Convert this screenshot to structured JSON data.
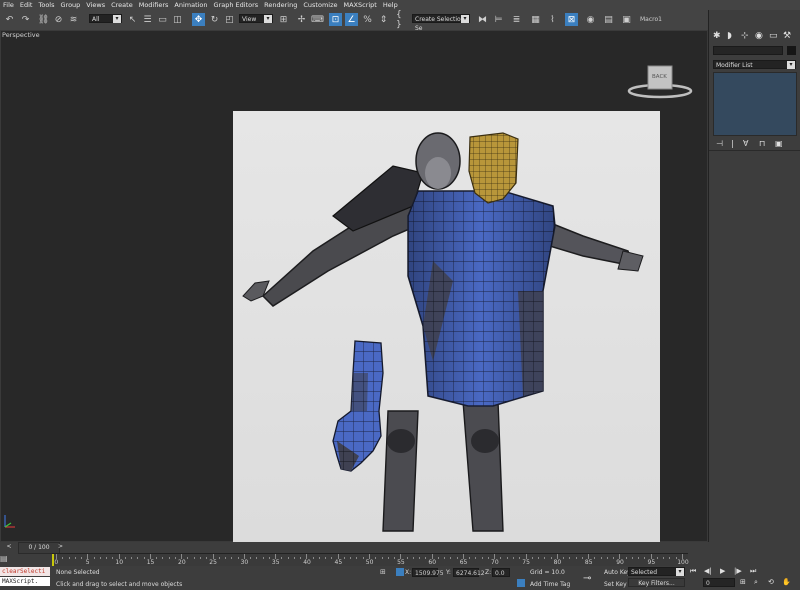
{
  "menu": [
    "File",
    "Edit",
    "Tools",
    "Group",
    "Views",
    "Create",
    "Modifiers",
    "Animation",
    "Graph Editors",
    "Rendering",
    "Customize",
    "MAXScript",
    "Help"
  ],
  "toolbar": {
    "filter_value": "All",
    "refcoord_value": "View",
    "named_selection_placeholder": "Create Selection Se",
    "macro_label": "Macro1"
  },
  "viewport": {
    "label": "Perspective",
    "viewcube_label": "BACK"
  },
  "right_panel": {
    "modifier_list_label": "Modifier List"
  },
  "timeline": {
    "frame_counter": "0 / 100",
    "ticks": [
      "0",
      "5",
      "10",
      "15",
      "20",
      "25",
      "30",
      "35",
      "40",
      "45",
      "50",
      "55",
      "60",
      "65",
      "70",
      "75",
      "80",
      "85",
      "90",
      "95",
      "100"
    ]
  },
  "status": {
    "maxscript_top": "clearSelecti",
    "maxscript_bottom": "MAXScript.",
    "selection_status": "None Selected",
    "prompt": "Click and drag to select and move objects",
    "x_label": "X:",
    "x_value": "1509.975",
    "y_label": "Y:",
    "y_value": "6274.612",
    "z_label": "Z:",
    "z_value": "0.0",
    "grid": "Grid = 10.0",
    "add_time_tag": "Add Time Tag",
    "auto_key": "Auto Key",
    "set_key": "Set Key",
    "selected_value": "Selected",
    "key_filters": "Key Filters...",
    "frame_value": "0"
  },
  "colors": {
    "accent": "#3b7fbf",
    "viewport_bg": "#282828",
    "ui_bg": "#444444",
    "mesh_blue": "#4a69c4",
    "mesh_gold": "#c8a33c"
  }
}
